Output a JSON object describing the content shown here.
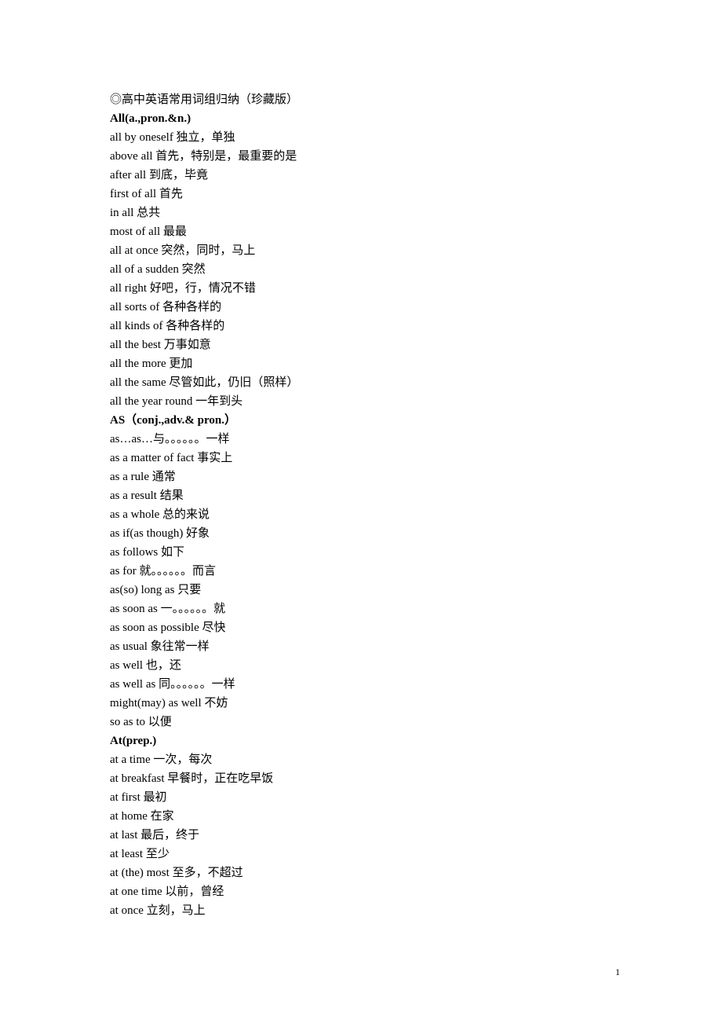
{
  "title": "◎高中英语常用词组归纳（珍藏版）",
  "sections": [
    {
      "heading": "All(a.,pron.&n.)",
      "entries": [
        "all by oneself 独立，单独",
        "above all 首先，特别是，最重要的是",
        "after all 到底，毕竟",
        "first of all 首先",
        "in all 总共",
        "most of all 最最",
        "all at once 突然，同时，马上",
        "all of a sudden 突然",
        "all right 好吧，行，情况不错",
        "all sorts of 各种各样的",
        "all kinds of 各种各样的",
        "all the best 万事如意",
        "all the more 更加",
        "all the same 尽管如此，仍旧（照样）",
        "all the year round 一年到头"
      ]
    },
    {
      "heading": "AS（conj.,adv.& pron.）",
      "entries": [
        "as…as…与。。。。。。一样",
        "as a matter of fact 事实上",
        "as a rule 通常",
        "as a result 结果",
        "as a whole 总的来说",
        "as if(as though) 好象",
        "as follows 如下",
        "as for 就。。。。。。而言",
        "as(so) long as 只要",
        "as soon as 一。。。。。。就",
        "as soon as possible 尽快",
        "as usual 象往常一样",
        "as well 也，还",
        "as well as 同。。。。。。一样",
        "might(may) as well 不妨",
        "so as to 以便"
      ]
    },
    {
      "heading": "At(prep.)",
      "entries": [
        "at a time 一次，每次",
        "at breakfast 早餐时，正在吃早饭",
        "at first 最初",
        "at home 在家",
        "at last 最后，终于",
        "at least 至少",
        "at (the) most 至多，不超过",
        "at one time 以前，曾经",
        "at once 立刻，马上"
      ]
    }
  ],
  "pageNumber": "1"
}
